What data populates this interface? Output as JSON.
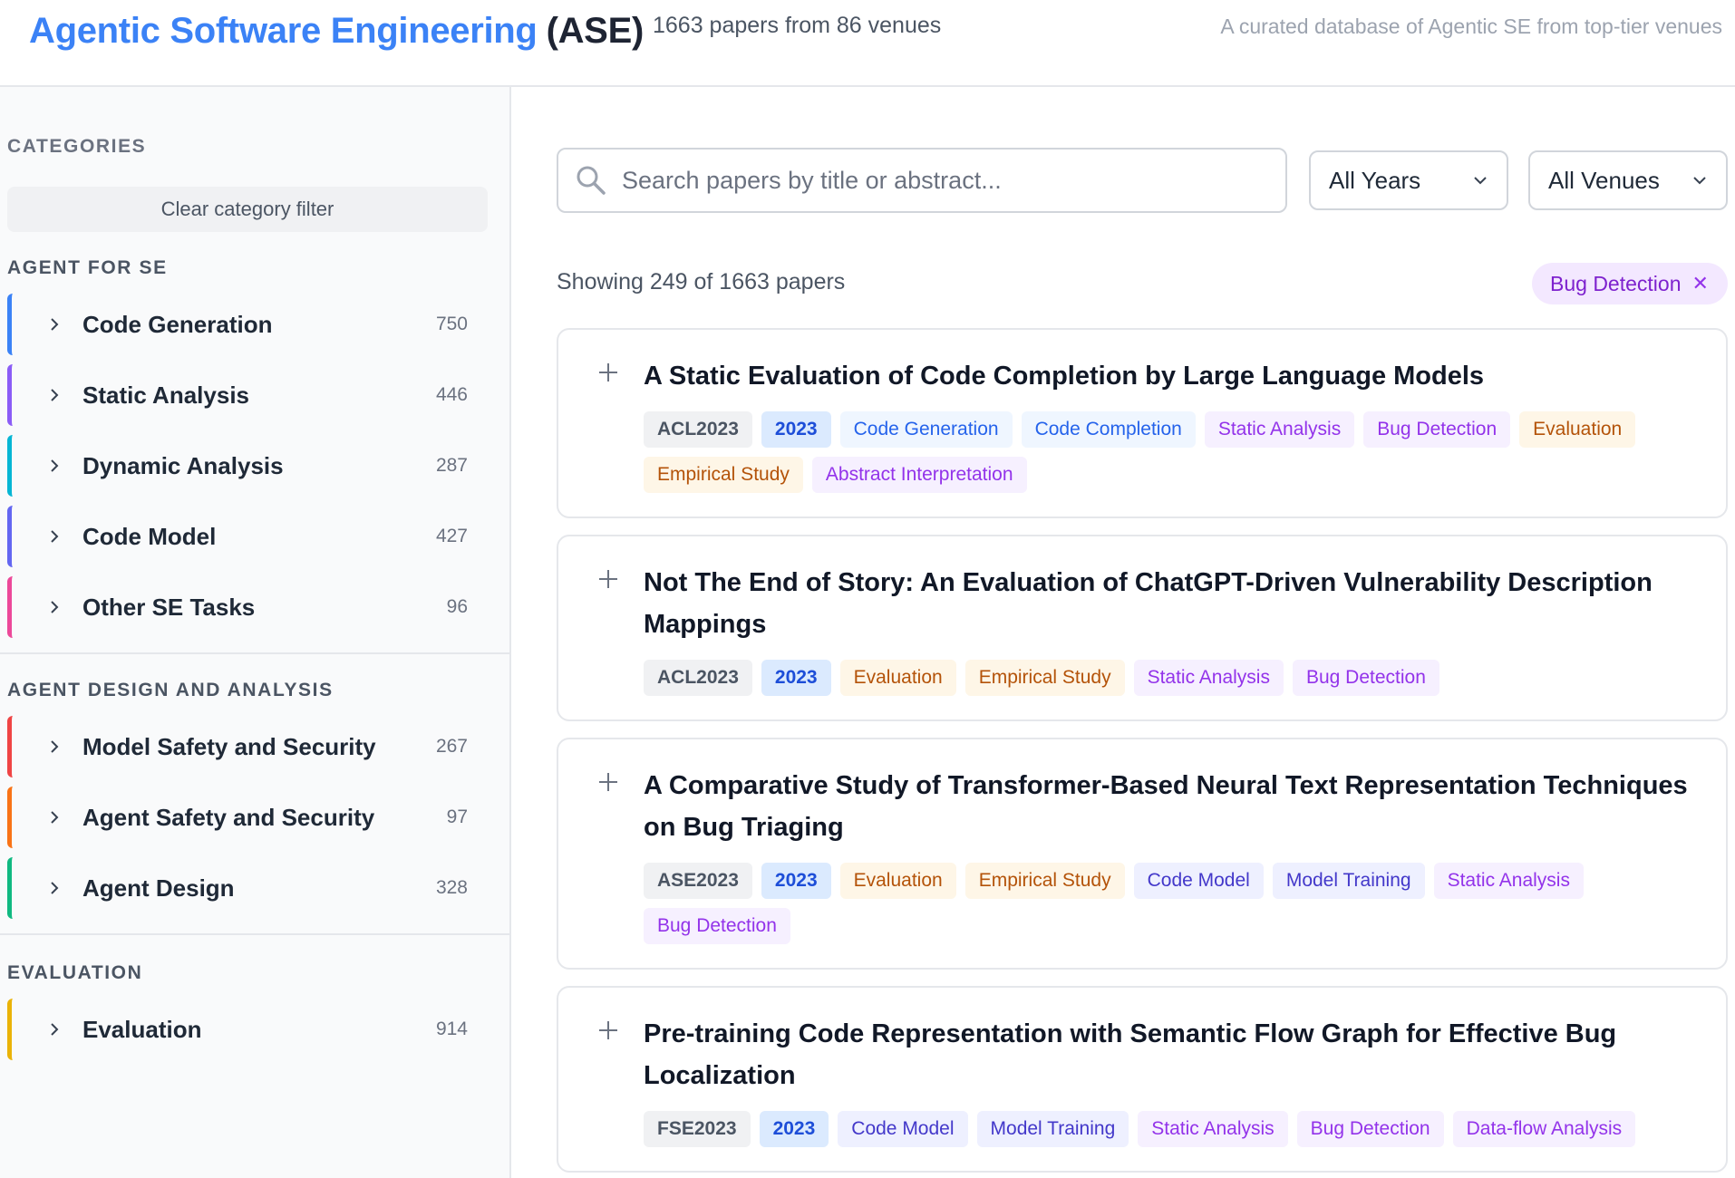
{
  "header": {
    "title": "Agentic Software Engineering",
    "abbr": "(ASE)",
    "count": "1663 papers from 86 venues",
    "tagline": "A curated database of Agentic SE from top-tier venues"
  },
  "sidebar": {
    "categories_title": "CATEGORIES",
    "clear_label": "Clear category filter",
    "groups": [
      {
        "title": "AGENT FOR SE",
        "items": [
          {
            "label": "Code Generation",
            "count": "750",
            "color": "#3b82f6"
          },
          {
            "label": "Static Analysis",
            "count": "446",
            "color": "#8b5cf6"
          },
          {
            "label": "Dynamic Analysis",
            "count": "287",
            "color": "#06b6d4"
          },
          {
            "label": "Code Model",
            "count": "427",
            "color": "#6366f1"
          },
          {
            "label": "Other SE Tasks",
            "count": "96",
            "color": "#ec4899"
          }
        ]
      },
      {
        "title": "AGENT DESIGN AND ANALYSIS",
        "items": [
          {
            "label": "Model Safety and Security",
            "count": "267",
            "color": "#ef4444"
          },
          {
            "label": "Agent Safety and Security",
            "count": "97",
            "color": "#f97316"
          },
          {
            "label": "Agent Design",
            "count": "328",
            "color": "#10b981"
          }
        ]
      },
      {
        "title": "EVALUATION",
        "items": [
          {
            "label": "Evaluation",
            "count": "914",
            "color": "#eab308"
          }
        ]
      }
    ]
  },
  "search": {
    "placeholder": "Search papers by title or abstract...",
    "years_label": "All Years",
    "venues_label": "All Venues"
  },
  "results": {
    "showing": "Showing 249 of 1663 papers",
    "active_filter": "Bug Detection"
  },
  "papers": [
    {
      "title": "A Static Evaluation of Code Completion by Large Language Models",
      "tags": [
        {
          "text": "ACL2023",
          "kind": "venue"
        },
        {
          "text": "2023",
          "kind": "year"
        },
        {
          "text": "Code Generation",
          "kind": "blue"
        },
        {
          "text": "Code Completion",
          "kind": "blue"
        },
        {
          "text": "Static Analysis",
          "kind": "purple"
        },
        {
          "text": "Bug Detection",
          "kind": "purple"
        },
        {
          "text": "Evaluation",
          "kind": "amber"
        },
        {
          "text": "Empirical Study",
          "kind": "amber"
        },
        {
          "text": "Abstract Interpretation",
          "kind": "purple"
        }
      ]
    },
    {
      "title": "Not The End of Story: An Evaluation of ChatGPT-Driven Vulnerability Description Mappings",
      "tags": [
        {
          "text": "ACL2023",
          "kind": "venue"
        },
        {
          "text": "2023",
          "kind": "year"
        },
        {
          "text": "Evaluation",
          "kind": "amber"
        },
        {
          "text": "Empirical Study",
          "kind": "amber"
        },
        {
          "text": "Static Analysis",
          "kind": "purple"
        },
        {
          "text": "Bug Detection",
          "kind": "purple"
        }
      ]
    },
    {
      "title": "A Comparative Study of Transformer-Based Neural Text Representation Techniques on Bug Triaging",
      "tags": [
        {
          "text": "ASE2023",
          "kind": "venue"
        },
        {
          "text": "2023",
          "kind": "year"
        },
        {
          "text": "Evaluation",
          "kind": "amber"
        },
        {
          "text": "Empirical Study",
          "kind": "amber"
        },
        {
          "text": "Code Model",
          "kind": "indigo"
        },
        {
          "text": "Model Training",
          "kind": "indigo"
        },
        {
          "text": "Static Analysis",
          "kind": "purple"
        },
        {
          "text": "Bug Detection",
          "kind": "purple"
        }
      ]
    },
    {
      "title": "Pre-training Code Representation with Semantic Flow Graph for Effective Bug Localization",
      "tags": [
        {
          "text": "FSE2023",
          "kind": "venue"
        },
        {
          "text": "2023",
          "kind": "year"
        },
        {
          "text": "Code Model",
          "kind": "indigo"
        },
        {
          "text": "Model Training",
          "kind": "indigo"
        },
        {
          "text": "Static Analysis",
          "kind": "purple"
        },
        {
          "text": "Bug Detection",
          "kind": "purple"
        },
        {
          "text": "Data-flow Analysis",
          "kind": "purple"
        }
      ]
    }
  ]
}
